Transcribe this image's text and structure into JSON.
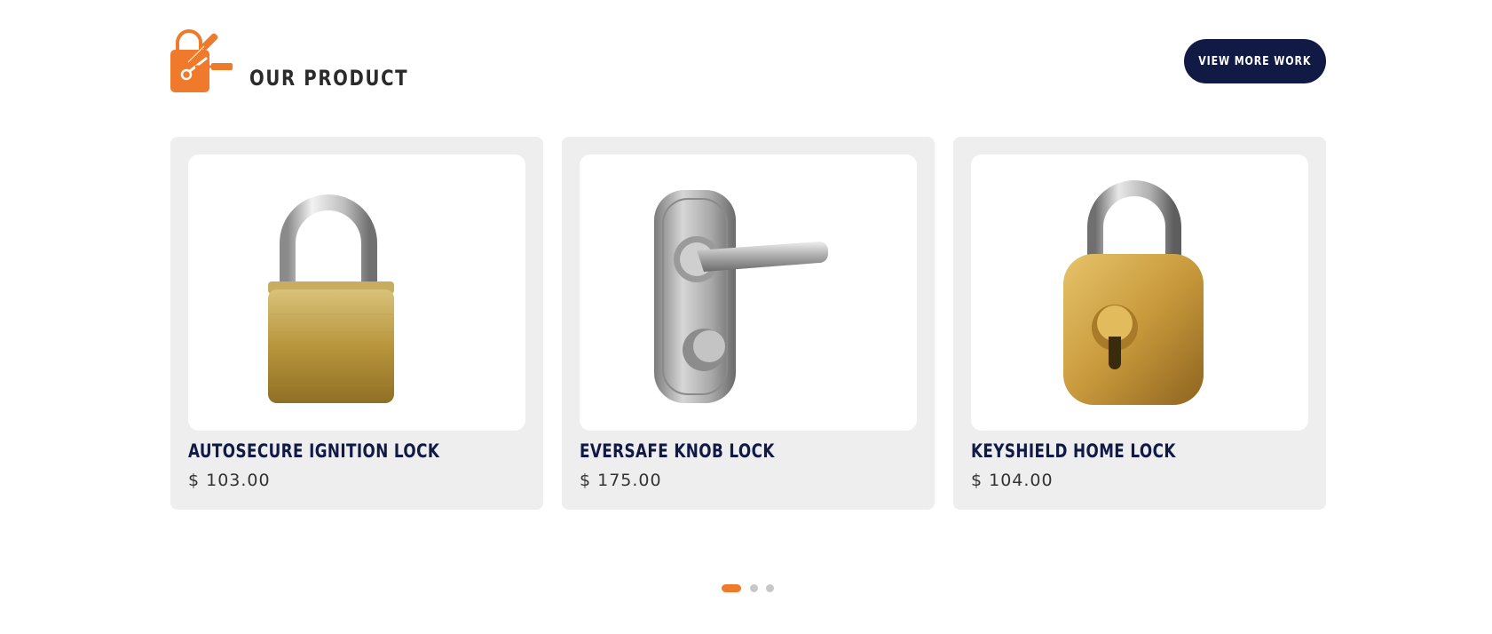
{
  "section": {
    "title": "OUR PRODUCT",
    "view_more_label": "VIEW MORE WORK"
  },
  "logo": {
    "icon": "lock-and-tools-icon",
    "color": "#f07a2b"
  },
  "products": [
    {
      "name": "AUTOSECURE IGNITION LOCK",
      "price": "$ 103.00",
      "image": "brass-padlock-image"
    },
    {
      "name": "EVERSAFE KNOB LOCK",
      "price": "$ 175.00",
      "image": "door-lever-handle-image"
    },
    {
      "name": "KEYSHIELD HOME LOCK",
      "price": "$ 104.00",
      "image": "gold-keyhole-padlock-image"
    }
  ],
  "carousel": {
    "page_count": 3,
    "active_index": 0
  },
  "colors": {
    "accent": "#f07a2b",
    "navy": "#111a45",
    "card_bg": "#eeeeee",
    "dot_inactive": "#c8c8c8"
  }
}
